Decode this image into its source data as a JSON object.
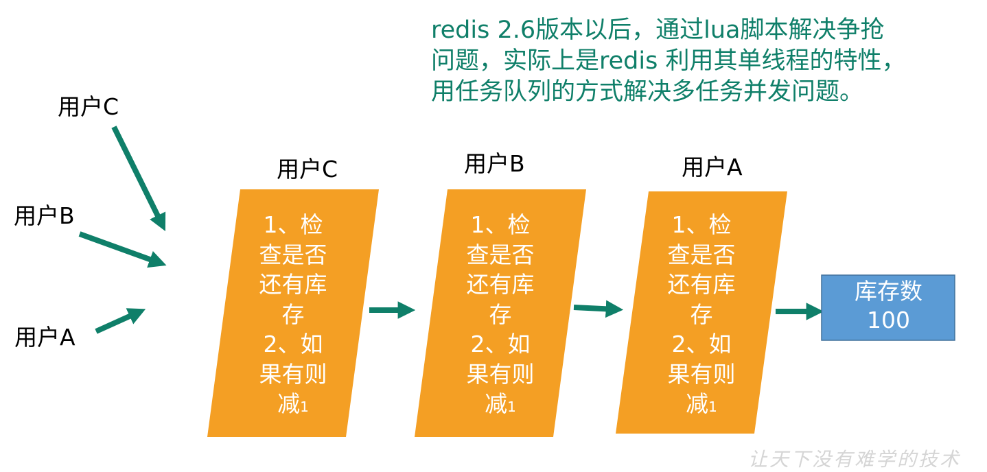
{
  "note": {
    "lines": [
      "redis 2.6版本以后，通过lua脚本解决争抢",
      "问题，实际上是redis 利用其单线程的特性，",
      "用任务队列的方式解决多任务并发问题。"
    ]
  },
  "users": {
    "c": "用户C",
    "b": "用户B",
    "a": "用户A"
  },
  "steps": [
    {
      "title": "用户C",
      "lines": [
        "1、检",
        "查是否",
        "还有库",
        "存",
        "2、如",
        "果有则"
      ],
      "last_main": "减",
      "last_sub": "1"
    },
    {
      "title": "用户B",
      "lines": [
        "1、检",
        "查是否",
        "还有库",
        "存",
        "2、如",
        "果有则"
      ],
      "last_main": "减",
      "last_sub": "1"
    },
    {
      "title": "用户A",
      "lines": [
        "1、检",
        "查是否",
        "还有库",
        "存",
        "2、如",
        "果有则"
      ],
      "last_main": "减",
      "last_sub": "1"
    }
  ],
  "stock": {
    "label": "库存数",
    "value": "100"
  },
  "watermark": "让天下没有难学的技术",
  "colors": {
    "arrow": "#0f7f69",
    "step_fill": "#f49f24",
    "stock_fill": "#5b9bd5",
    "stock_border": "#41719c",
    "note_text": "#0f7f69"
  }
}
